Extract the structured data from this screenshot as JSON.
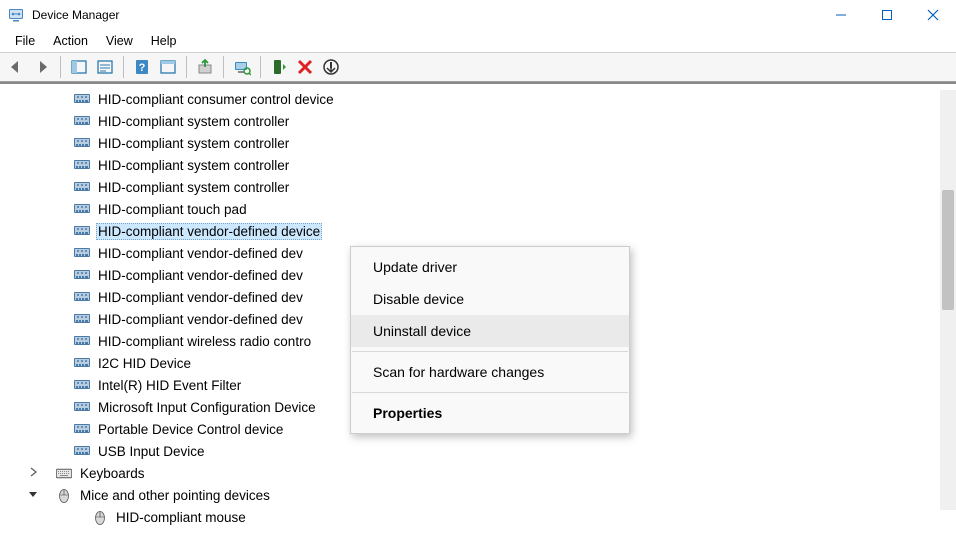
{
  "window": {
    "title": "Device Manager"
  },
  "menubar": {
    "file": "File",
    "action": "Action",
    "view": "View",
    "help": "Help"
  },
  "tree": {
    "items": [
      {
        "label": "HID-compliant consumer control device",
        "icon": "hid",
        "indent": 3
      },
      {
        "label": "HID-compliant system controller",
        "icon": "hid",
        "indent": 3
      },
      {
        "label": "HID-compliant system controller",
        "icon": "hid",
        "indent": 3
      },
      {
        "label": "HID-compliant system controller",
        "icon": "hid",
        "indent": 3
      },
      {
        "label": "HID-compliant system controller",
        "icon": "hid",
        "indent": 3
      },
      {
        "label": "HID-compliant touch pad",
        "icon": "hid",
        "indent": 3
      },
      {
        "label": "HID-compliant vendor-defined device",
        "icon": "hid",
        "indent": 3,
        "selected": true
      },
      {
        "label": "HID-compliant vendor-defined dev",
        "icon": "hid",
        "indent": 3
      },
      {
        "label": "HID-compliant vendor-defined dev",
        "icon": "hid",
        "indent": 3
      },
      {
        "label": "HID-compliant vendor-defined dev",
        "icon": "hid",
        "indent": 3
      },
      {
        "label": "HID-compliant vendor-defined dev",
        "icon": "hid",
        "indent": 3
      },
      {
        "label": "HID-compliant wireless radio contro",
        "icon": "hid",
        "indent": 3
      },
      {
        "label": "I2C HID Device",
        "icon": "hid",
        "indent": 3
      },
      {
        "label": "Intel(R) HID Event Filter",
        "icon": "hid",
        "indent": 3
      },
      {
        "label": "Microsoft Input Configuration Device",
        "icon": "hid",
        "indent": 3
      },
      {
        "label": "Portable Device Control device",
        "icon": "hid",
        "indent": 3
      },
      {
        "label": "USB Input Device",
        "icon": "hid",
        "indent": 3
      },
      {
        "label": "Keyboards",
        "icon": "keyboard",
        "indent": 2,
        "expander": ">"
      },
      {
        "label": "Mice and other pointing devices",
        "icon": "mouse",
        "indent": 2,
        "expander": "v"
      },
      {
        "label": "HID-compliant mouse",
        "icon": "mouse",
        "indent": 4
      }
    ]
  },
  "context_menu": {
    "update": "Update driver",
    "disable": "Disable device",
    "uninstall": "Uninstall device",
    "scan": "Scan for hardware changes",
    "properties": "Properties"
  }
}
